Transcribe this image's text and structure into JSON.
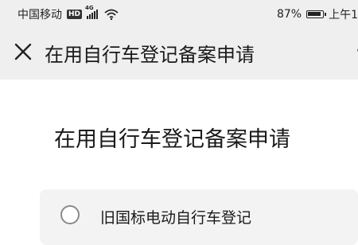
{
  "status_bar": {
    "carrier": "中国移动",
    "hd_badge": "HD",
    "network_type": "4G",
    "battery_percent": "87%",
    "time": "上午1"
  },
  "app_bar": {
    "title": "在用自行车登记备案申请"
  },
  "content": {
    "title": "在用自行车登记备案申请",
    "options": [
      {
        "label": "旧国标电动自行车登记",
        "selected": false
      }
    ]
  },
  "colors": {
    "app_bar_background": "#efefef",
    "option_card_background": "#f3f3f3",
    "radio_border": "#8a8a8a"
  },
  "icons": {
    "close": "close-icon",
    "more": "more-icon",
    "radio": "radio-unchecked-icon"
  }
}
